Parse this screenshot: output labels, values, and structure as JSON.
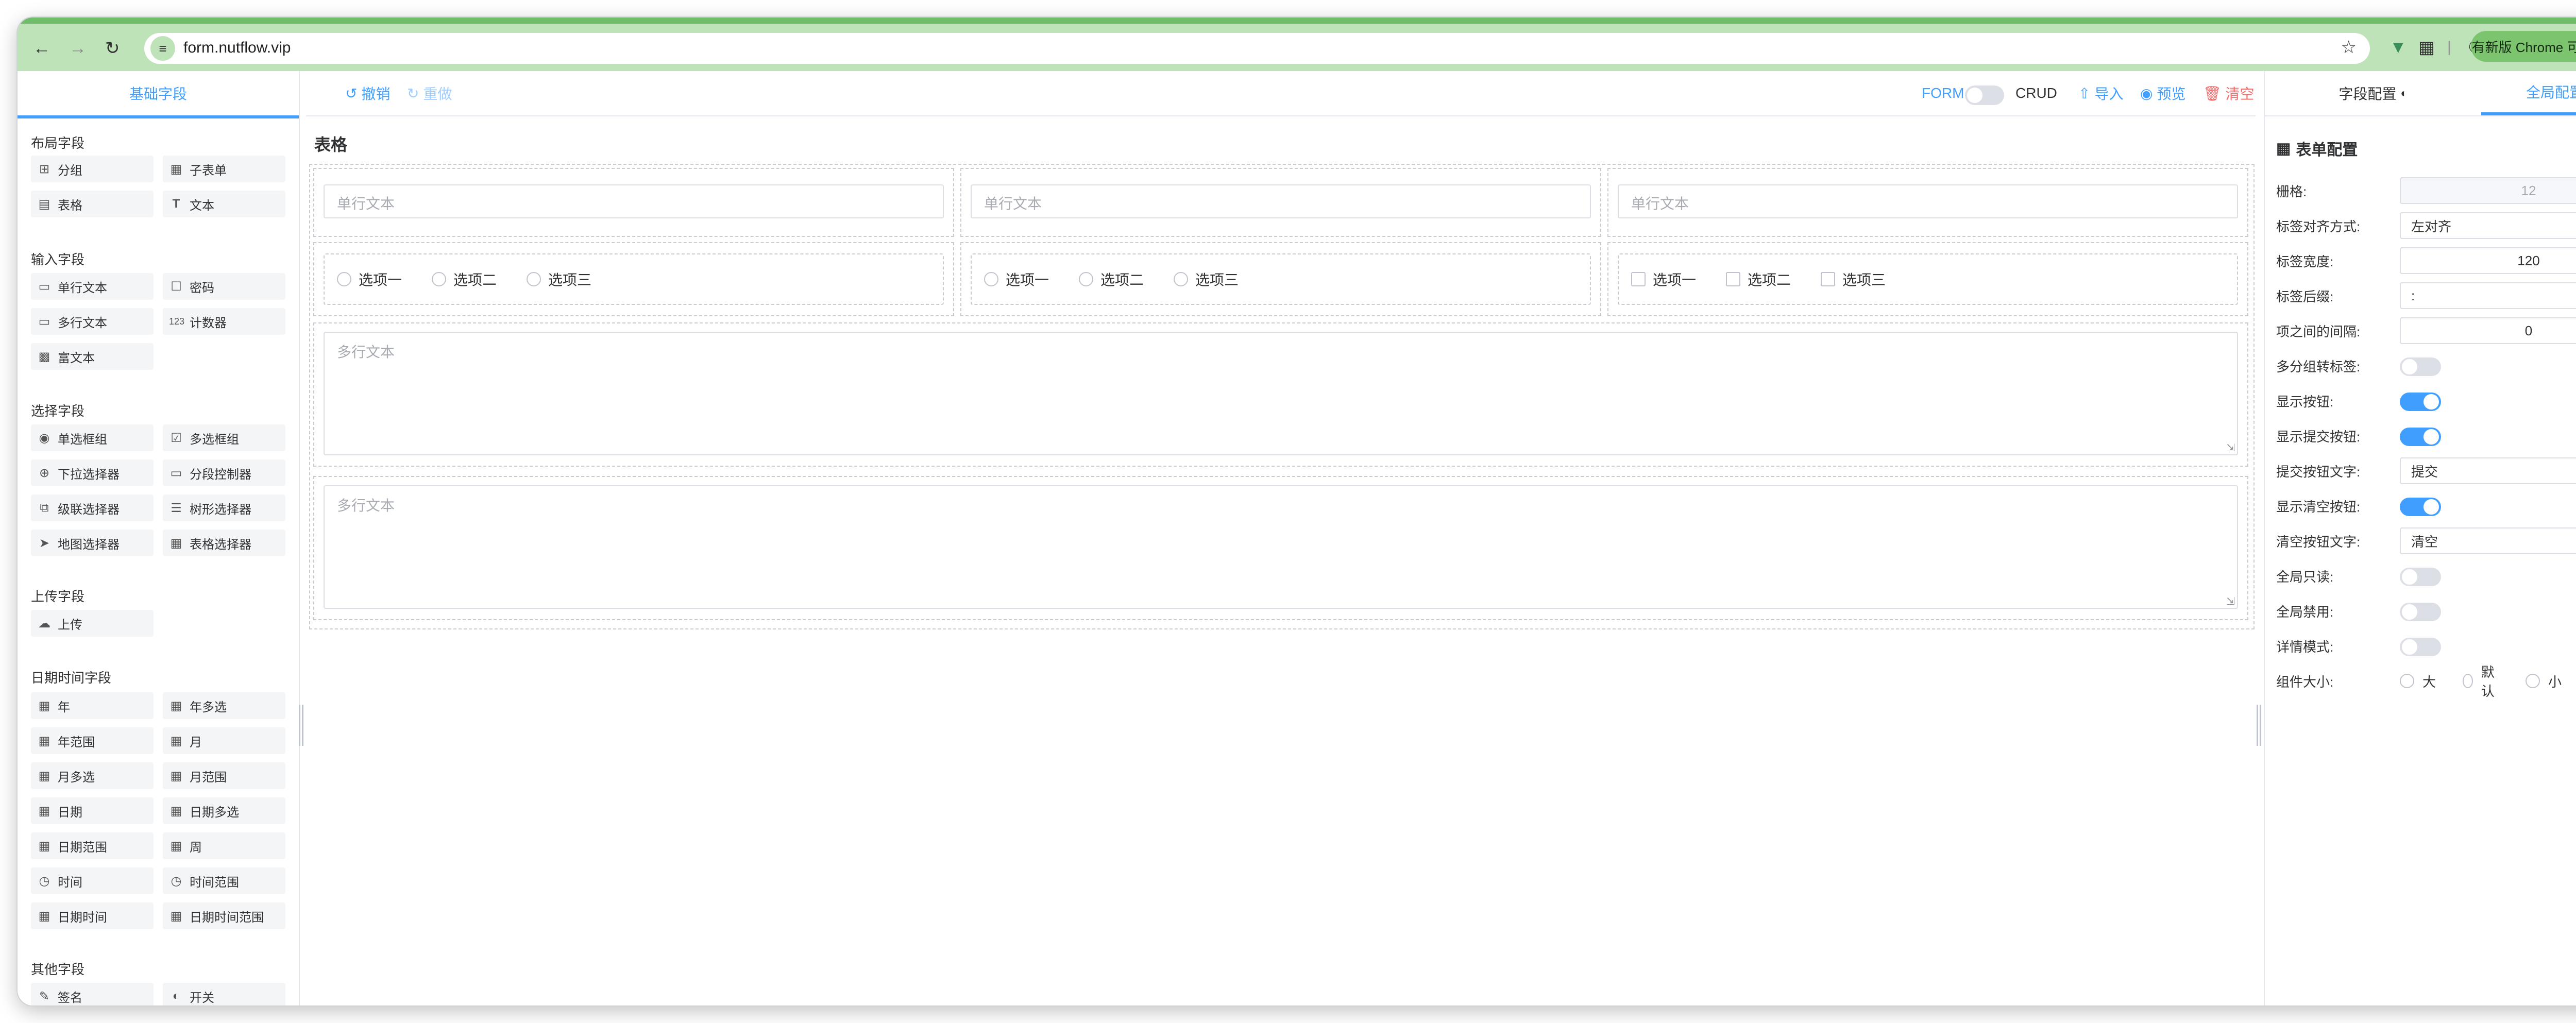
{
  "browser": {
    "url": "form.nutflow.vip",
    "update_label": "有新版 Chrome 可用",
    "back_icon": "arrow-left-icon",
    "forward_icon": "arrow-right-icon",
    "reload_icon": "reload-icon",
    "accent": "#6fbd68"
  },
  "left_panel": {
    "tab": "基础字段",
    "sections": [
      {
        "title": "布局字段",
        "items": [
          {
            "label": "分组",
            "icon": "grid-icon"
          },
          {
            "label": "子表单",
            "icon": "table-icon"
          },
          {
            "label": "表格",
            "icon": "table-layout-icon"
          },
          {
            "label": "文本",
            "icon": "text-icon"
          }
        ]
      },
      {
        "title": "输入字段",
        "items": [
          {
            "label": "单行文本",
            "icon": "input-icon"
          },
          {
            "label": "密码",
            "icon": "lock-icon"
          },
          {
            "label": "多行文本",
            "icon": "textarea-icon"
          },
          {
            "label": "计数器",
            "icon": "counter-icon"
          },
          {
            "label": "富文本",
            "icon": "richtext-icon"
          }
        ]
      },
      {
        "title": "选择字段",
        "items": [
          {
            "label": "单选框组",
            "icon": "radio-icon"
          },
          {
            "label": "多选框组",
            "icon": "checkbox-icon"
          },
          {
            "label": "下拉选择器",
            "icon": "select-icon"
          },
          {
            "label": "分段控制器",
            "icon": "segmented-icon"
          },
          {
            "label": "级联选择器",
            "icon": "cascader-icon"
          },
          {
            "label": "树形选择器",
            "icon": "tree-icon"
          },
          {
            "label": "地图选择器",
            "icon": "map-icon"
          },
          {
            "label": "表格选择器",
            "icon": "table-select-icon"
          }
        ]
      },
      {
        "title": "上传字段",
        "items": [
          {
            "label": "上传",
            "icon": "upload-icon"
          }
        ]
      },
      {
        "title": "日期时间字段",
        "items": [
          {
            "label": "年",
            "icon": "calendar-icon"
          },
          {
            "label": "年多选",
            "icon": "calendar-icon"
          },
          {
            "label": "年范围",
            "icon": "calendar-icon"
          },
          {
            "label": "月",
            "icon": "calendar-icon"
          },
          {
            "label": "月多选",
            "icon": "calendar-icon"
          },
          {
            "label": "月范围",
            "icon": "calendar-icon"
          },
          {
            "label": "日期",
            "icon": "calendar-icon"
          },
          {
            "label": "日期多选",
            "icon": "calendar-icon"
          },
          {
            "label": "日期范围",
            "icon": "calendar-icon"
          },
          {
            "label": "周",
            "icon": "calendar-icon"
          },
          {
            "label": "时间",
            "icon": "clock-icon"
          },
          {
            "label": "时间范围",
            "icon": "clock-icon"
          },
          {
            "label": "日期时间",
            "icon": "datetime-icon"
          },
          {
            "label": "日期时间范围",
            "icon": "datetime-icon"
          }
        ]
      },
      {
        "title": "其他字段",
        "items": [
          {
            "label": "签名",
            "icon": "pen-icon"
          },
          {
            "label": "开关",
            "icon": "switch-icon"
          }
        ]
      }
    ]
  },
  "toolbar": {
    "undo": "撤销",
    "redo": "重做",
    "form_label": "FORM",
    "crud_label": "CRUD",
    "import": "导入",
    "preview": "预览",
    "clear": "清空",
    "colors": {
      "primary": "#409eff",
      "danger": "#f56c6c",
      "muted": "#a0cfff"
    }
  },
  "canvas": {
    "title": "表格",
    "row1_placeholders": [
      "单行文本",
      "单行文本",
      "单行文本"
    ],
    "row2": {
      "col1": [
        "选项一",
        "选项二",
        "选项三"
      ],
      "col2": [
        "选项一",
        "选项二",
        "选项三"
      ],
      "col3": [
        "选项一",
        "选项二",
        "选项三"
      ]
    },
    "textarea_placeholders": [
      "多行文本",
      "多行文本"
    ]
  },
  "right_panel": {
    "tab_field": "字段配置",
    "tab_global": "全局配置",
    "section_title": "表单配置",
    "rows": {
      "grid": {
        "label": "栅格:",
        "value": "12"
      },
      "align": {
        "label": "标签对齐方式:",
        "value": "左对齐"
      },
      "label_width": {
        "label": "标签宽度:",
        "value": "120"
      },
      "label_suffix": {
        "label": "标签后缀:",
        "value": ":"
      },
      "gap": {
        "label": "项之间的间隔:",
        "value": "0"
      },
      "multi_group": {
        "label": "多分组转标签:",
        "on": false
      },
      "show_buttons": {
        "label": "显示按钮:",
        "on": true
      },
      "show_submit": {
        "label": "显示提交按钮:",
        "on": true
      },
      "submit_text": {
        "label": "提交按钮文字:",
        "value": "提交"
      },
      "show_clear": {
        "label": "显示清空按钮:",
        "on": true
      },
      "clear_text": {
        "label": "清空按钮文字:",
        "value": "清空"
      },
      "readonly": {
        "label": "全局只读:",
        "on": false
      },
      "disabled": {
        "label": "全局禁用:",
        "on": false
      },
      "detail": {
        "label": "详情模式:",
        "on": false
      },
      "size": {
        "label": "组件大小:",
        "options": [
          "大",
          "默认",
          "小"
        ]
      }
    }
  }
}
